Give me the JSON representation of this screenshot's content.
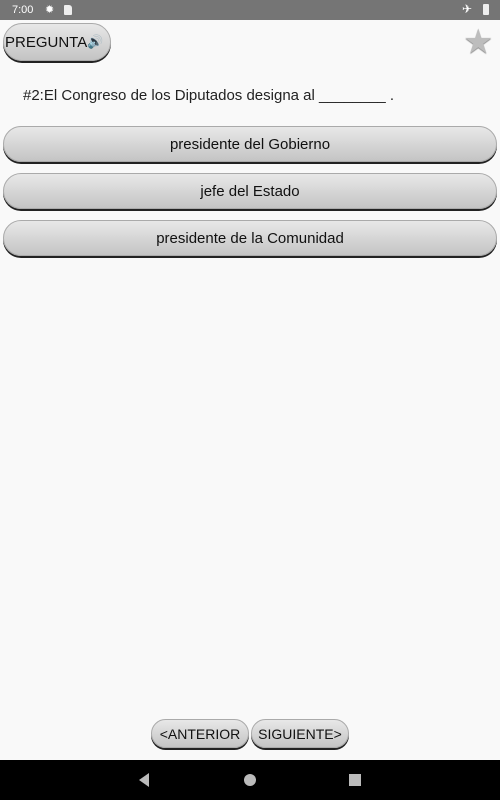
{
  "status_bar": {
    "time": "7:00",
    "icons": [
      "gear-icon",
      "sim-card-icon",
      "airplane-mode-icon",
      "battery-icon"
    ]
  },
  "header": {
    "question_button_label": "PREGUNTA",
    "speaker_icon": "🔊",
    "favorite_icon": "★"
  },
  "question": {
    "text": "#2:El Congreso de los Diputados designa al ________ ."
  },
  "options": [
    {
      "label": "presidente del Gobierno"
    },
    {
      "label": "jefe del Estado"
    },
    {
      "label": "presidente de la Comunidad"
    }
  ],
  "navigation": {
    "previous_label": "<ANTERIOR",
    "next_label": "SIGUIENTE>"
  },
  "system_nav": {
    "back": "back-icon",
    "home": "home-icon",
    "recents": "recents-icon"
  }
}
